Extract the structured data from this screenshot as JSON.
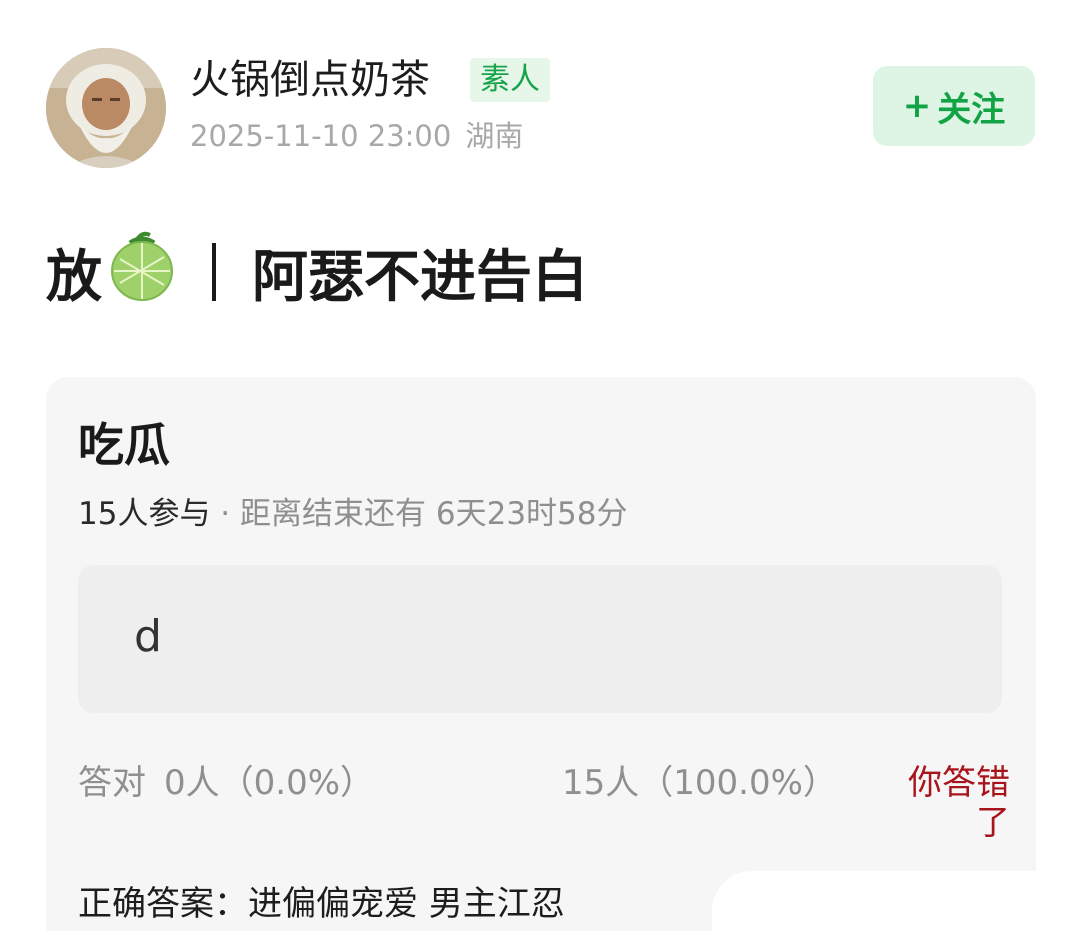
{
  "header": {
    "username": "火锅倒点奶茶",
    "badge": "素人",
    "date": "2025-11-10 23:00",
    "location": "湖南",
    "follow_plus": "+",
    "follow_label": "关注"
  },
  "post": {
    "title_prefix": "放",
    "title_main": "阿瑟不进告白"
  },
  "quiz": {
    "title": "吃瓜",
    "participants": "15人参与",
    "separator": " · ",
    "countdown": "距离结束还有 6天23时58分",
    "answer_option": "d",
    "correct_label": "答对",
    "correct_count": "0人（0.0%）",
    "option_count": "15人（100.0%）",
    "wrong_notice": "你答错了",
    "correct_answer": "正确答案：进偏偏宠爱 男主江忍"
  },
  "colors": {
    "brand_green": "#12a344",
    "badge_bg": "#e6f7ea",
    "follow_bg": "#def5e5",
    "wrong_red": "#a8141b",
    "card_bg": "#f6f6f6"
  },
  "icons": {
    "avatar": "avatar",
    "title_emoji": "melon-icon"
  }
}
